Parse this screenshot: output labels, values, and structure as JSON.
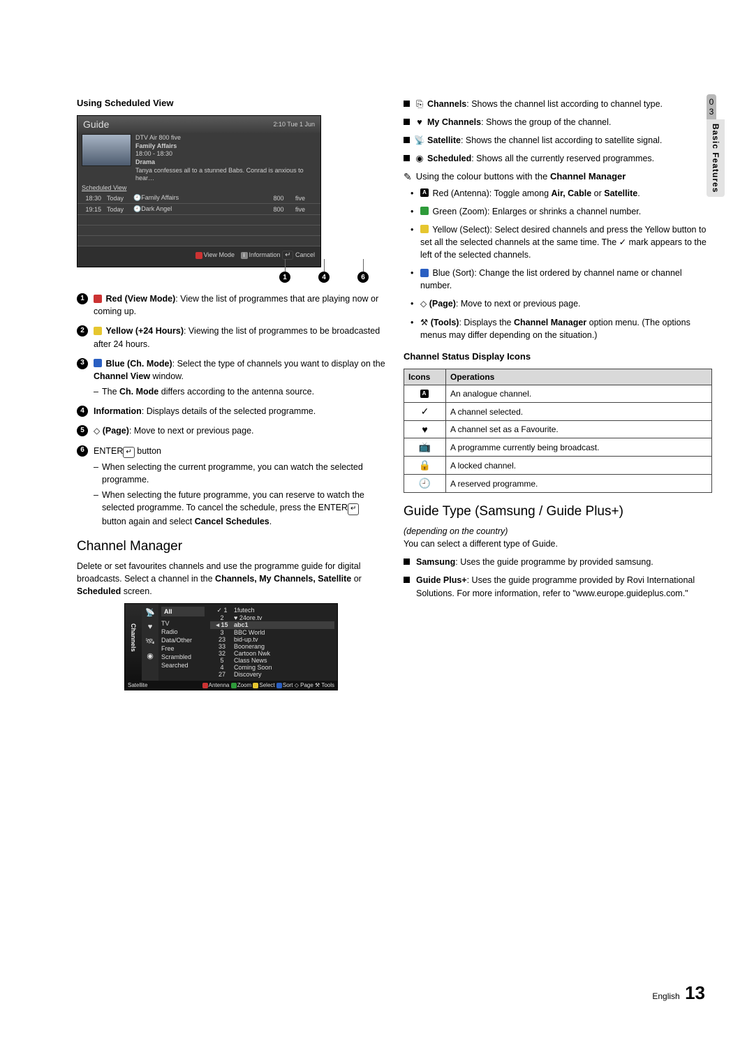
{
  "sidebar": {
    "chapter_num": "03",
    "chapter_name": "Basic Features"
  },
  "left": {
    "heading_scheduled": "Using Scheduled View",
    "guide": {
      "title": "Guide",
      "clock": "2:10 Tue 1 Jun",
      "ch_info": "DTV Air 800 five",
      "prog_name": "Family Affairs",
      "prog_time": "18:00 - 18:30",
      "prog_genre": "Drama",
      "prog_desc": "Tanya confesses all to a stunned Babs. Conrad is anxious to hear…",
      "tab": "Scheduled View",
      "rows": [
        {
          "time": "18:30",
          "day": "Today",
          "name": "Family Affairs",
          "num": "800",
          "ch": "five"
        },
        {
          "time": "19:15",
          "day": "Today",
          "name": "Dark Angel",
          "num": "800",
          "ch": "five"
        }
      ],
      "foot_view": "View Mode",
      "foot_info": "Information",
      "foot_cancel": "Cancel",
      "callouts": [
        "1",
        "4",
        "6"
      ]
    },
    "items": [
      {
        "n": "1",
        "pre_chip": "red",
        "lead": "Red (View Mode)",
        "rest": ": View the list of programmes that are playing now or coming up."
      },
      {
        "n": "2",
        "pre_chip": "yellow",
        "lead": "Yellow (+24 Hours)",
        "rest": ": Viewing the list of programmes to be broadcasted after 24 hours."
      },
      {
        "n": "3",
        "pre_chip": "blue",
        "lead": "Blue (Ch. Mode)",
        "rest": ": Select the type of channels you want to display on the ",
        "b2": "Channel View",
        "rest2": " window.",
        "sub": "The ",
        "sub_b": "Ch. Mode",
        "sub_rest": " differs according to the antenna source."
      },
      {
        "n": "4",
        "lead": "Information",
        "rest": ": Displays details of the selected programme."
      },
      {
        "n": "5",
        "pg": true,
        "lead": "(Page)",
        "rest": ": Move to next or previous page."
      },
      {
        "n": "6",
        "enter": true,
        "lead": "button",
        "sub1": "When selecting the current programme, you can watch the selected programme.",
        "sub2a": "When selecting the future programme, you can reserve to watch the selected programme. To cancel the schedule, press the ",
        "sub2b": " button again and select ",
        "sub2c": "Cancel Schedules",
        "sub2d": "."
      }
    ],
    "cm_heading": "Channel Manager",
    "cm_text": "Delete or set favourites channels and use the programme guide for digital broadcasts. Select a channel in the ",
    "cm_text_b": "Channels, My Channels, Satellite",
    "cm_text2": " or ",
    "cm_text_b2": "Scheduled",
    "cm_text3": " screen.",
    "cm_ui": {
      "side_label": "Channels",
      "side_bottom": "Satellite",
      "cat_head": "All",
      "cats": [
        "TV",
        "Radio",
        "Data/Other",
        "Free",
        "Scrambled",
        "Searched"
      ],
      "right": [
        {
          "n": "✓ 1",
          "name": "1futech"
        },
        {
          "n": "2",
          "name": "♥ 24ore.tv"
        },
        {
          "n": "15",
          "name": "abc1",
          "sel": true
        },
        {
          "n": "3",
          "name": "BBC World"
        },
        {
          "n": "23",
          "name": "bid-up.tv"
        },
        {
          "n": "33",
          "name": "Boonerang"
        },
        {
          "n": "32",
          "name": "Cartoon Nwk"
        },
        {
          "n": "5",
          "name": "Class News"
        },
        {
          "n": "4",
          "name": "Coming Soon"
        },
        {
          "n": "27",
          "name": "Discovery"
        }
      ],
      "foot": [
        "Antenna",
        "Zoom",
        "Select",
        "Sort",
        "Page",
        "Tools"
      ]
    }
  },
  "right": {
    "list1": [
      {
        "icon": "⎘",
        "lead": "Channels",
        "rest": ": Shows the channel list according to channel type."
      },
      {
        "icon": "♥",
        "lead": "My Channels",
        "rest": ": Shows the group of the channel."
      },
      {
        "icon": "📡",
        "lead": "Satellite",
        "rest": ": Shows the channel list according to satellite signal."
      },
      {
        "icon": "◉",
        "lead": "Scheduled",
        "rest": ": Shows all the currently reserved programmes."
      }
    ],
    "note_text": "Using the colour buttons with the ",
    "note_b": "Channel Manager",
    "bullets": [
      {
        "chip": "red_a",
        "lead": "Red (Antenna)",
        "rest": ": Toggle among ",
        "b2": "Air, Cable",
        "rest2": " or ",
        "b3": "Satellite",
        "rest3": "."
      },
      {
        "chip": "green",
        "lead": "Green (Zoom)",
        "rest": ": Enlarges or shrinks a channel number."
      },
      {
        "chip": "yellow",
        "lead": "Yellow (Select)",
        "rest": ": Select desired channels and press the Yellow button to set all the selected channels at the same time. The ✓ mark appears to the left of the selected channels."
      },
      {
        "chip": "blue",
        "lead": "Blue (Sort)",
        "rest": ": Change the list ordered by channel name or channel number."
      },
      {
        "pg": true,
        "lead": "(Page)",
        "rest": ": Move to next or previous page."
      },
      {
        "tools": true,
        "lead": "(Tools)",
        "rest": ": Displays the ",
        "b2": "Channel Manager",
        "rest2": " option menu. (The options menus may differ depending on the situation.)"
      }
    ],
    "status_heading": "Channel Status Display Icons",
    "table": {
      "h1": "Icons",
      "h2": "Operations",
      "rows": [
        {
          "i": "A",
          "t": "An analogue channel."
        },
        {
          "i": "✓",
          "t": "A channel selected."
        },
        {
          "i": "♥",
          "t": "A channel set as a Favourite."
        },
        {
          "i": "📺",
          "t": "A programme currently being broadcast."
        },
        {
          "i": "🔒",
          "t": "A locked channel."
        },
        {
          "i": "🕘",
          "t": "A reserved programme."
        }
      ]
    },
    "guide_type_heading": "Guide Type (Samsung / Guide Plus+)",
    "guide_type_sub": "(depending on the country)",
    "guide_type_p": "You can select a different type of Guide.",
    "gt_items": [
      {
        "lead": "Samsung",
        "rest": ": Uses the guide programme by provided samsung."
      },
      {
        "lead": "Guide Plus+",
        "rest": ": Uses the guide programme provided by Rovi International Solutions. For more information, refer to \"www.europe.guideplus.com.\""
      }
    ]
  },
  "footer": {
    "lang": "English",
    "page": "13"
  }
}
